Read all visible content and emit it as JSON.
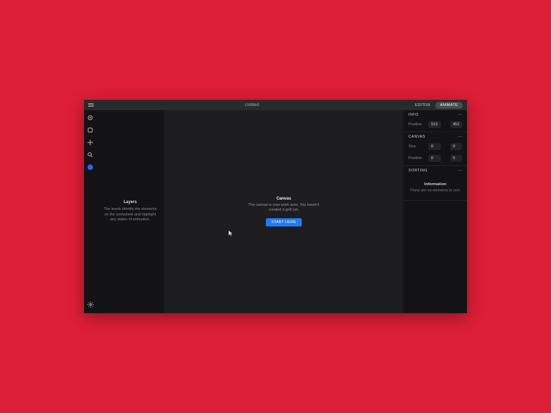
{
  "titlebar": {
    "title": "Untitled",
    "modes": {
      "editor": "EDITOR",
      "animate": "ANIMATE"
    }
  },
  "layers": {
    "heading": "Layers",
    "desc": "The levels identify the elements on the worksheet and highlight any states of animation."
  },
  "canvas": {
    "heading": "Canvas",
    "desc": "The canvas is your work area. You haven't created a grid yet.",
    "button": "START HERE"
  },
  "inspector": {
    "info": {
      "title": "INFO",
      "position_label": "Position",
      "pos_x": "513",
      "pos_y": "452"
    },
    "canvas_sect": {
      "title": "CANVAS",
      "size_label": "Size",
      "size_w": "0",
      "size_h": "0",
      "pos_label": "Position",
      "pos_x": "0",
      "pos_y": "0"
    },
    "sorting": {
      "title": "SORTING",
      "empty_title": "Information",
      "empty_desc": "There are no elements to sort."
    }
  }
}
